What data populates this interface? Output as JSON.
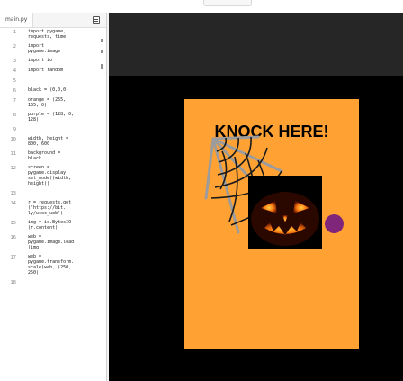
{
  "editor": {
    "tab_label": "main.py",
    "lines": [
      {
        "n": "1",
        "t": "import pygame,\nrequests, time"
      },
      {
        "n": "2",
        "t": "import\npygame.image"
      },
      {
        "n": "3",
        "t": "import io"
      },
      {
        "n": "4",
        "t": "import random"
      },
      {
        "n": "5",
        "t": ""
      },
      {
        "n": "6",
        "t": "black = (0,0,0)"
      },
      {
        "n": "7",
        "t": "orange = (255,\n165, 0)"
      },
      {
        "n": "8",
        "t": "purple = (128, 0,\n128)"
      },
      {
        "n": "9",
        "t": ""
      },
      {
        "n": "10",
        "t": "width, height =\n800, 600"
      },
      {
        "n": "11",
        "t": "background =\nblack"
      },
      {
        "n": "12",
        "t": "screen =\npygame.display.\nset_mode((width,\nheight))"
      },
      {
        "n": "13",
        "t": ""
      },
      {
        "n": "14",
        "t": "r = requests.get\n('https://bit.\nly/wcoc_web')"
      },
      {
        "n": "15",
        "t": "img = io.BytesIO\n(r.content)"
      },
      {
        "n": "16",
        "t": "web =\npygame.image.load\n(img)"
      },
      {
        "n": "17",
        "t": "web =\npygame.transform.\nscale(web, (250,\n250))"
      },
      {
        "n": "18",
        "t": ""
      }
    ]
  },
  "game": {
    "sign_text": "KNOCK HERE!",
    "colors": {
      "panel": "#ffa233",
      "dot": "#80267a",
      "background": "#000000"
    }
  }
}
